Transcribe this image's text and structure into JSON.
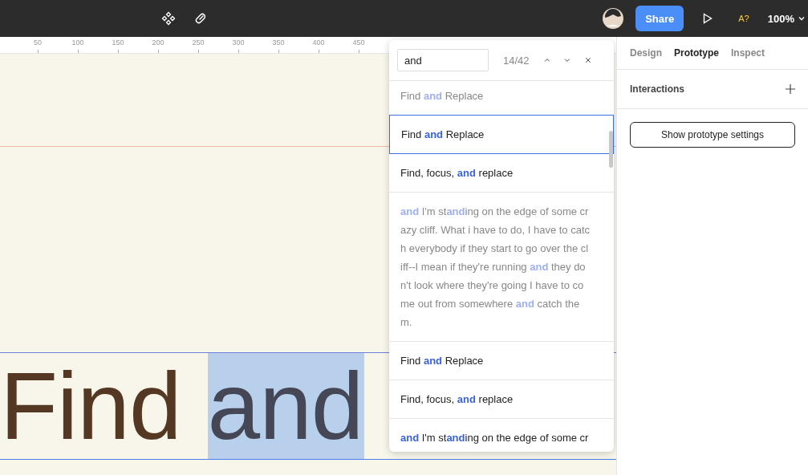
{
  "toolbar": {
    "share": "Share",
    "badge": "A?",
    "zoom": "100%"
  },
  "ruler": {
    "marks": [
      "50",
      "100",
      "150",
      "200",
      "250",
      "300",
      "350",
      "400",
      "450"
    ]
  },
  "canvas": {
    "words": [
      {
        "text": "Find",
        "selected": false
      },
      {
        "text": "and",
        "selected": true
      }
    ]
  },
  "find_popup": {
    "query": "and",
    "count": "14/42",
    "results": [
      {
        "lines": [
          "Find **and** Replace"
        ],
        "dimmed": true,
        "selected": false
      },
      {
        "lines": [
          "Find **and** Replace"
        ],
        "dimmed": false,
        "selected": true
      },
      {
        "lines": [
          "Find, focus, **and** replace"
        ],
        "dimmed": false,
        "selected": false
      },
      {
        "lines": [
          "**and** I'm st**and**ing on the edge of some cr",
          "azy cliff. What i have to do, I have to catc",
          "h everybody if they start to go over the cl",
          "iff--I mean if they're running **and** they do",
          "n't look where they're going I have to co",
          "me out from somewhere **and** catch the",
          "m."
        ],
        "dimmed": true,
        "selected": false
      },
      {
        "lines": [
          "Find **and** Replace"
        ],
        "dimmed": false,
        "selected": false
      },
      {
        "lines": [
          "Find, focus, **and** replace"
        ],
        "dimmed": false,
        "selected": false
      },
      {
        "lines": [
          "**and** I'm st**and**ing on the edge of some cr"
        ],
        "dimmed": false,
        "selected": false
      }
    ]
  },
  "panel": {
    "tabs": [
      {
        "label": "Design",
        "selected": false
      },
      {
        "label": "Prototype",
        "selected": true
      },
      {
        "label": "Inspect",
        "selected": false
      }
    ],
    "section": "Interactions",
    "button": "Show prototype settings"
  }
}
